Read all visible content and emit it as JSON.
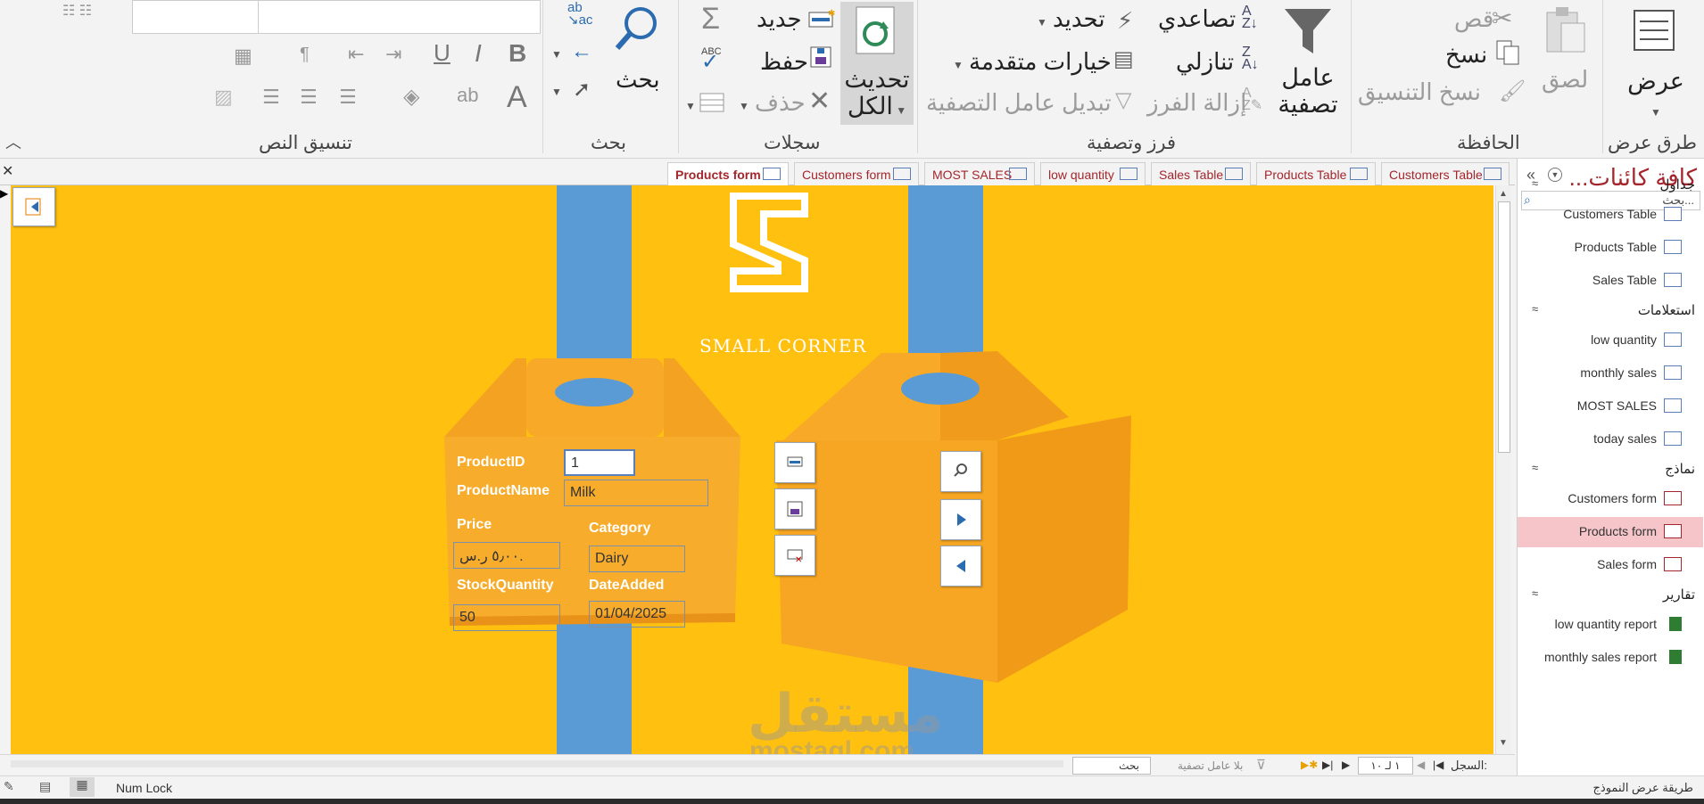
{
  "ribbon": {
    "groups": {
      "views": "طرق عرض",
      "clipboard": "الحافظة",
      "sort_filter": "فرز وتصفية",
      "records": "سجلات",
      "find": "بحث",
      "text_format": "تنسيق النص"
    },
    "views": {
      "view_label": "عرض"
    },
    "clipboard": {
      "cut": "قص",
      "copy": "نسخ",
      "paste": "لصق",
      "format_painter": "نسخ التنسيق"
    },
    "sort_filter": {
      "filter_line1": "عامل",
      "filter_line2": "تصفية",
      "ascending": "تصاعدي",
      "descending": "تنازلي",
      "remove_sort": "إزالة الفرز",
      "selection": "تحديد",
      "advanced": "خيارات متقدمة",
      "toggle_filter": "تبديل عامل التصفية"
    },
    "records": {
      "refresh_line1": "تحديث",
      "refresh_line2": "الكل",
      "new": "جديد",
      "save": "حفظ",
      "delete": "حذف"
    },
    "find": {
      "find": "بحث",
      "replace_icon_text": "ab\nac"
    }
  },
  "nav": {
    "title": "كافة كائنات...",
    "search_placeholder": "بحث...",
    "sections": [
      {
        "label": "جداول",
        "items": [
          "Customers Table",
          "Products Table",
          "Sales Table"
        ]
      },
      {
        "label": "استعلامات",
        "items": [
          "low quantity",
          "monthly sales",
          "MOST SALES",
          "today sales"
        ]
      },
      {
        "label": "نماذج",
        "items": [
          "Customers form",
          "Products form",
          "Sales form"
        ]
      },
      {
        "label": "تقارير",
        "items": [
          "low quantity report",
          "monthly sales report"
        ]
      }
    ],
    "active_item": "Products form"
  },
  "tabs": [
    "Products form",
    "Customers form",
    "MOST SALES",
    "low quantity",
    "Sales Table",
    "Products Table",
    "Customers Table"
  ],
  "active_tab": "Products form",
  "form": {
    "brand": "SMALL CORNER",
    "watermark_ar": "مستقل",
    "watermark_en": "mostaql.com",
    "fields": {
      "productid_label": "ProductID",
      "productid_value": "1",
      "productname_label": "ProductName",
      "productname_value": "Milk",
      "price_label": "Price",
      "price_value": "٥٫٠٠ ر.س.",
      "category_label": "Category",
      "category_value": "Dairy",
      "stock_label": "StockQuantity",
      "stock_value": "50",
      "date_label": "DateAdded",
      "date_value": "01/04/2025"
    }
  },
  "recbar": {
    "record_label": "السجل:",
    "record_pos": "١ لـ ١٠",
    "no_filter": "بلا عامل تصفية",
    "search": "بحث"
  },
  "status": {
    "mode": "طريقة عرض النموذج",
    "numlock": "Num Lock"
  },
  "colors": {
    "form_bg": "#ffc010",
    "stripe": "#5b9bd5",
    "box": "#f6a623",
    "accent_red": "#a4262c"
  }
}
